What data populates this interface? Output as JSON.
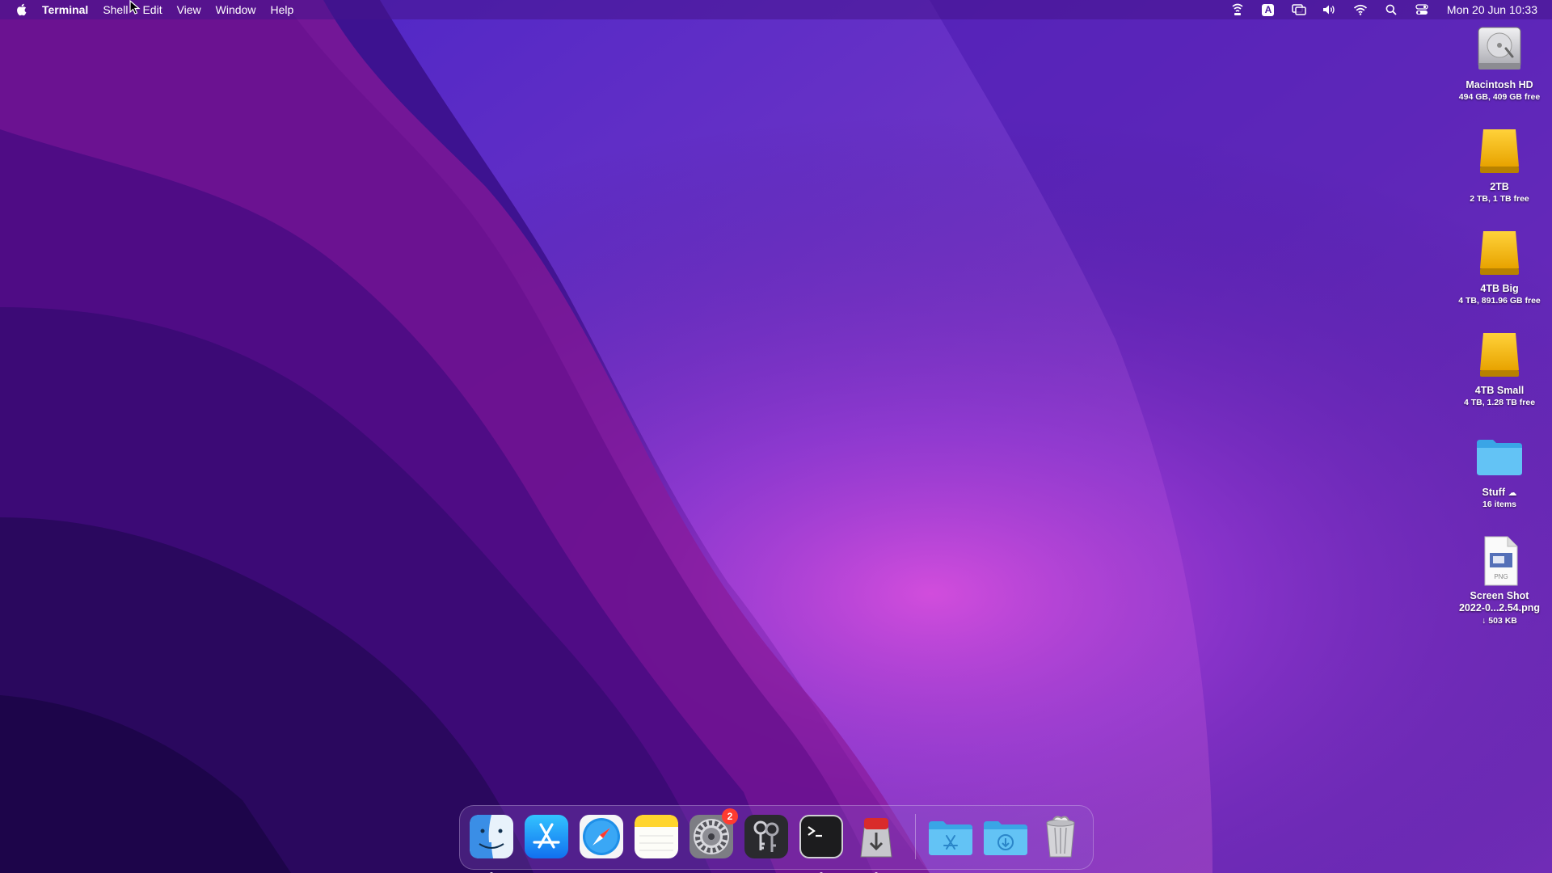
{
  "menubar": {
    "app_name": "Terminal",
    "menus": [
      "Shell",
      "Edit",
      "View",
      "Window",
      "Help"
    ],
    "clock": "Mon 20 Jun  10:33",
    "status_icons": [
      "airdrop-icon",
      "input-source-icon",
      "screen-mirroring-icon",
      "volume-icon",
      "wifi-icon",
      "spotlight-search-icon",
      "control-center-icon"
    ],
    "input_source_letter": "A"
  },
  "desktop_items": [
    {
      "name": "Macintosh HD",
      "detail": "494 GB, 409 GB free",
      "icon": "internal-drive-icon"
    },
    {
      "name": "2TB",
      "detail": "2 TB, 1 TB free",
      "icon": "external-drive-icon"
    },
    {
      "name": "4TB Big",
      "detail": "4 TB, 891.96 GB free",
      "icon": "external-drive-icon"
    },
    {
      "name": "4TB Small",
      "detail": "4 TB, 1.28 TB free",
      "icon": "external-drive-icon"
    },
    {
      "name": "Stuff",
      "detail": "16 items",
      "icon": "folder-icon"
    },
    {
      "name": "Screen Shot\n2022-0...2.54.png",
      "detail": "↓ 503 KB",
      "icon": "png-file-icon"
    }
  ],
  "dock": {
    "apps": [
      {
        "name": "Finder",
        "icon": "finder-icon",
        "running": true
      },
      {
        "name": "App Store",
        "icon": "app-store-icon",
        "running": false
      },
      {
        "name": "Safari",
        "icon": "safari-icon",
        "running": false
      },
      {
        "name": "Notes",
        "icon": "notes-icon",
        "running": false
      },
      {
        "name": "System Preferences",
        "icon": "system-preferences-icon",
        "running": false,
        "badge": "2"
      },
      {
        "name": "Keychain Access",
        "icon": "keychain-icon",
        "running": false
      },
      {
        "name": "Terminal",
        "icon": "terminal-icon",
        "running": true
      },
      {
        "name": "Transmission",
        "icon": "transmission-icon",
        "running": true
      }
    ],
    "stacks": [
      {
        "name": "Applications",
        "icon": "applications-folder-icon"
      },
      {
        "name": "Downloads",
        "icon": "downloads-folder-icon"
      },
      {
        "name": "Trash",
        "icon": "trash-icon"
      }
    ]
  },
  "colors": {
    "wallpaper_base": "#3a0f86",
    "wallpaper_glow": "#c23bd8",
    "drive_yellow": "#f5b800",
    "folder_blue": "#4fb7ee",
    "badge_red": "#ff3b30"
  }
}
